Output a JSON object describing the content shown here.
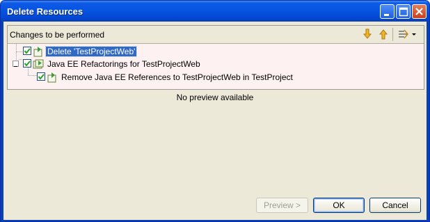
{
  "window": {
    "title": "Delete Resources"
  },
  "panel": {
    "title": "Changes to be performed",
    "tree": [
      {
        "label": "Delete 'TestProjectWeb'",
        "checked": true,
        "selected": true
      },
      {
        "label": "Java EE Refactorings for TestProjectWeb",
        "checked": true,
        "expanded": true
      },
      {
        "label": "Remove Java EE References to TestProjectWeb in TestProject",
        "checked": true
      }
    ]
  },
  "preview": {
    "message": "No preview available"
  },
  "buttons": {
    "preview": "Preview >",
    "ok": "OK",
    "cancel": "Cancel"
  },
  "colors": {
    "titlebar": "#0654e0",
    "selection": "#316ac5",
    "dialog_bg": "#ece9d8"
  }
}
